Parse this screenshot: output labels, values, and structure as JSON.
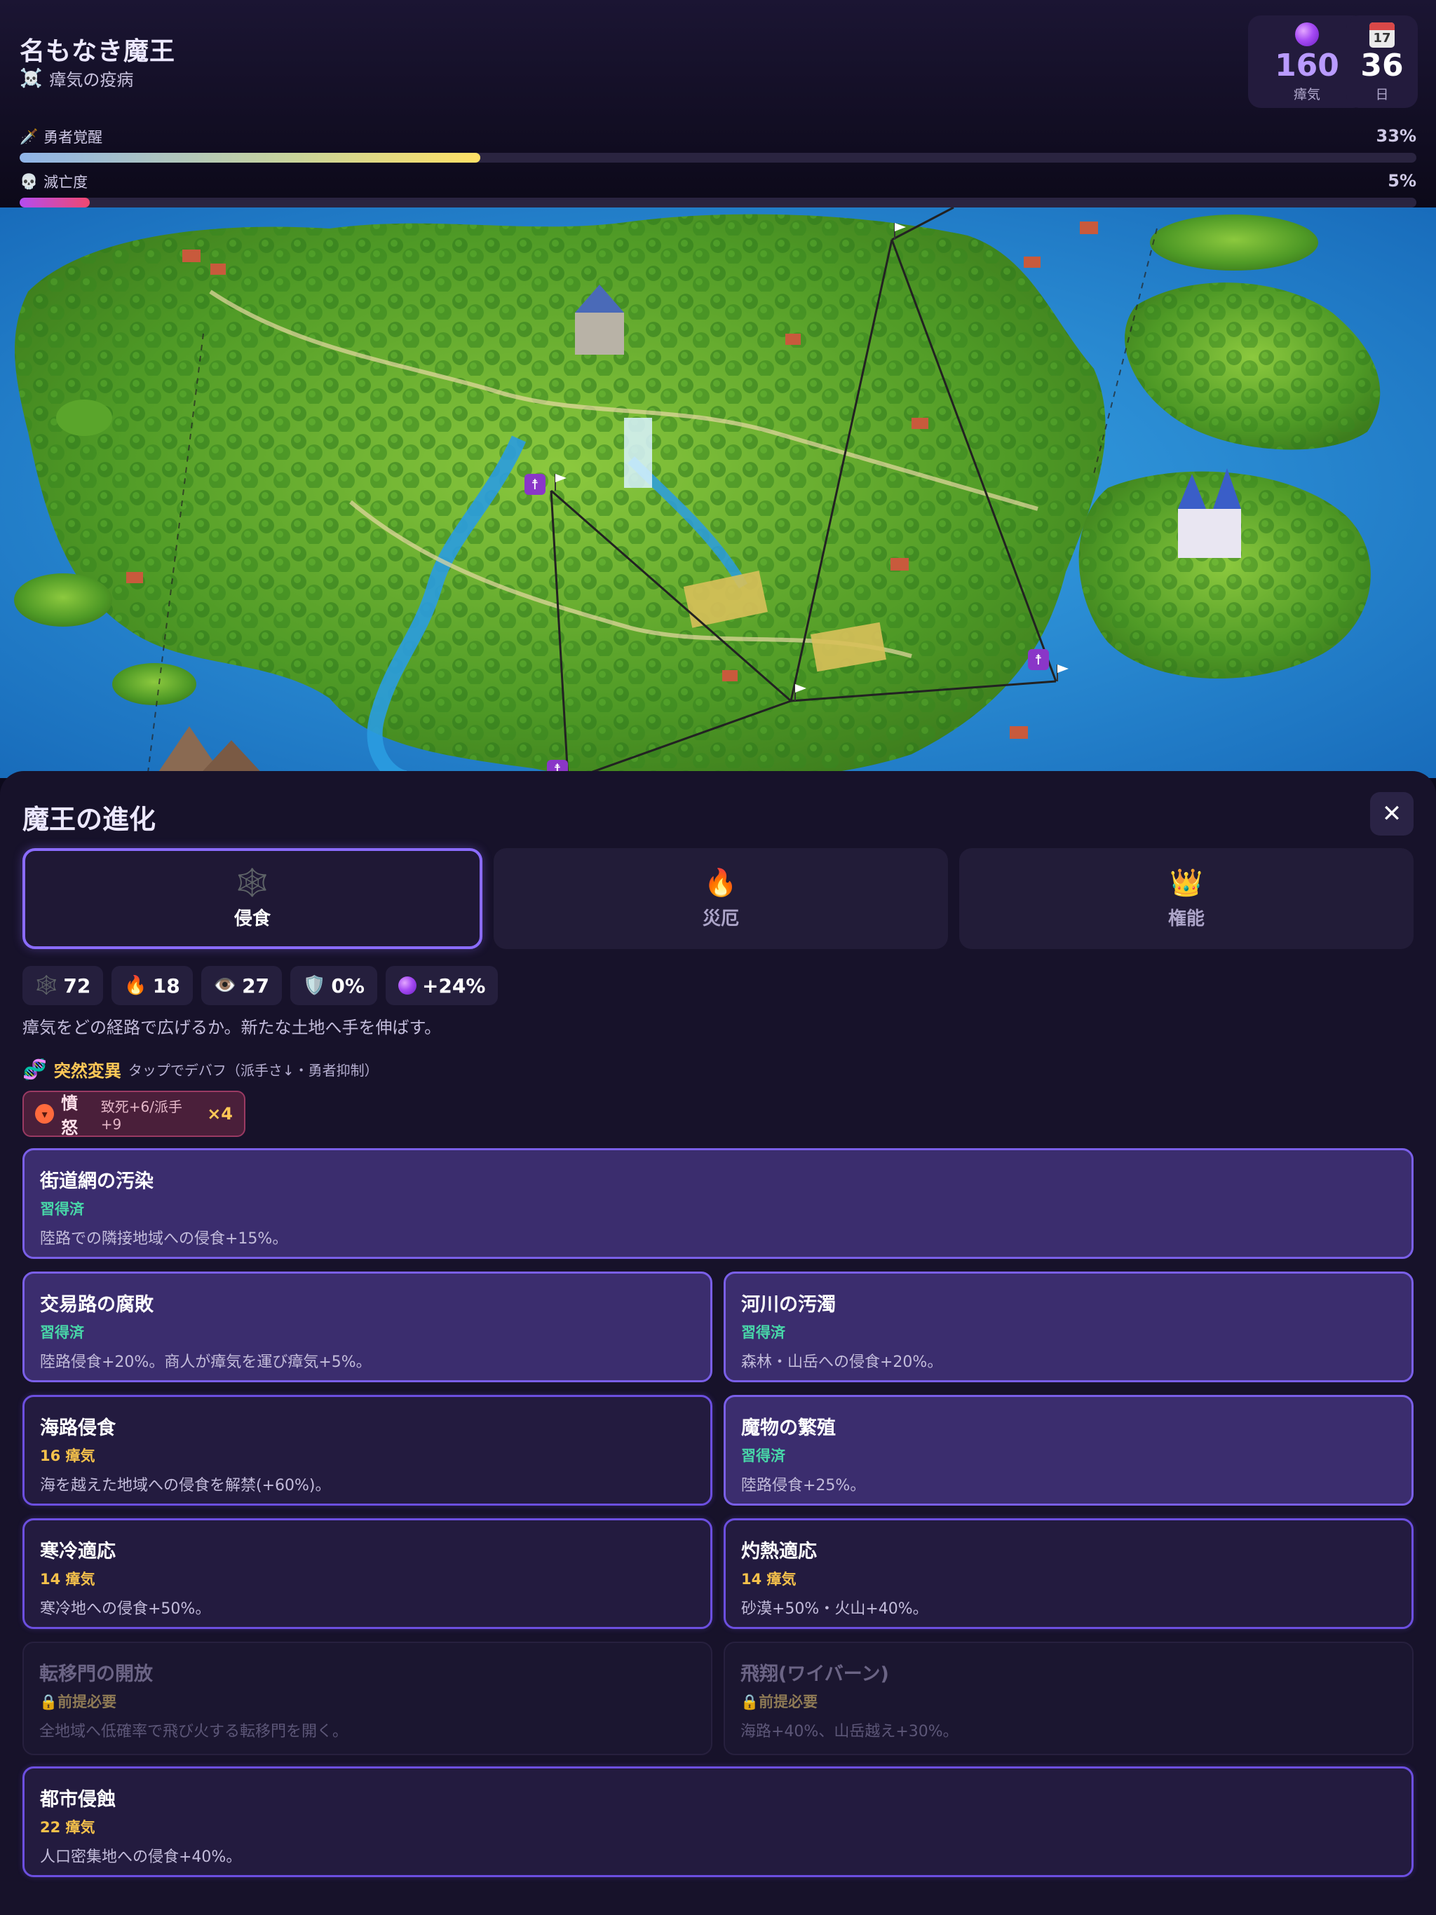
{
  "header": {
    "title": "名もなき魔王",
    "subtitle_icon": "☠️",
    "subtitle": "瘴気の疫病",
    "miasma": {
      "value": "160",
      "label": "瘴気"
    },
    "day": {
      "calendar": "17",
      "value": "36",
      "label": "日"
    },
    "hero": {
      "icon": "🗡️",
      "label": "勇者覚醒",
      "pct_text": "33%",
      "fraction": 0.33
    },
    "doom": {
      "icon": "💀",
      "label": "滅亡度",
      "pct_text": "5%",
      "fraction": 0.05
    }
  },
  "panel": {
    "title": "魔王の進化",
    "close": "✕",
    "tabs": [
      {
        "icon": "🕸️",
        "label": "侵食",
        "active": true
      },
      {
        "icon": "🔥",
        "label": "災厄",
        "active": false
      },
      {
        "icon": "👑",
        "label": "権能",
        "active": false
      }
    ],
    "chips": [
      {
        "icon": "🕸️",
        "value": "72"
      },
      {
        "icon": "🔥",
        "value": "18"
      },
      {
        "icon": "👁️",
        "value": "27"
      },
      {
        "icon": "🛡️",
        "value": "0%"
      },
      {
        "icon": "orb",
        "value": "+24%"
      }
    ],
    "description": "瘴気をどの経路で広げるか。新たな土地へ手を伸ばす。",
    "mutation": {
      "icon": "🧬",
      "title": "突然変異",
      "hint": "タップでデバフ（派手さ↓・勇者抑制）"
    },
    "rage": {
      "icon": "😡",
      "name": "憤怒",
      "effect": "致死+6/派手+9",
      "count": "×4"
    },
    "cards": [
      {
        "name": "街道網の汚染",
        "status": "習得済",
        "desc": "陸路での隣接地域への侵食+15%。",
        "state": "learned"
      },
      {
        "name": "交易路の腐敗",
        "status": "習得済",
        "desc": "陸路侵食+20%。商人が瘴気を運び瘴気+5%。",
        "state": "learned"
      },
      {
        "name": "河川の汚濁",
        "status": "習得済",
        "desc": "森林・山岳への侵食+20%。",
        "state": "learned"
      },
      {
        "name": "海路侵食",
        "status": "16 瘴気",
        "desc": "海を越えた地域への侵食を解禁(+60%)。",
        "state": "available"
      },
      {
        "name": "魔物の繁殖",
        "status": "習得済",
        "desc": "陸路侵食+25%。",
        "state": "learned"
      },
      {
        "name": "寒冷適応",
        "status": "14 瘴気",
        "desc": "寒冷地への侵食+50%。",
        "state": "available"
      },
      {
        "name": "灼熱適応",
        "status": "14 瘴気",
        "desc": "砂漠+50%・火山+40%。",
        "state": "available"
      },
      {
        "name": "転移門の開放",
        "status": "🔒前提必要",
        "desc": "全地域へ低確率で飛び火する転移門を開く。",
        "state": "locked"
      },
      {
        "name": "飛翔(ワイバーン)",
        "status": "🔒前提必要",
        "desc": "海路+40%、山岳越え+30%。",
        "state": "locked"
      },
      {
        "name": "都市侵蝕",
        "status": "22 瘴気",
        "desc": "人口密集地への侵食+40%。",
        "state": "available"
      }
    ]
  },
  "colors": {
    "accent": "#8b6cff",
    "learned_status": "#48d6a8",
    "cost_status": "#f5c14b",
    "hero_bar_end": "#ffe066",
    "doom_bar_end": "#f04870",
    "sea": "#1f86d6",
    "land": "#5fae2e"
  }
}
